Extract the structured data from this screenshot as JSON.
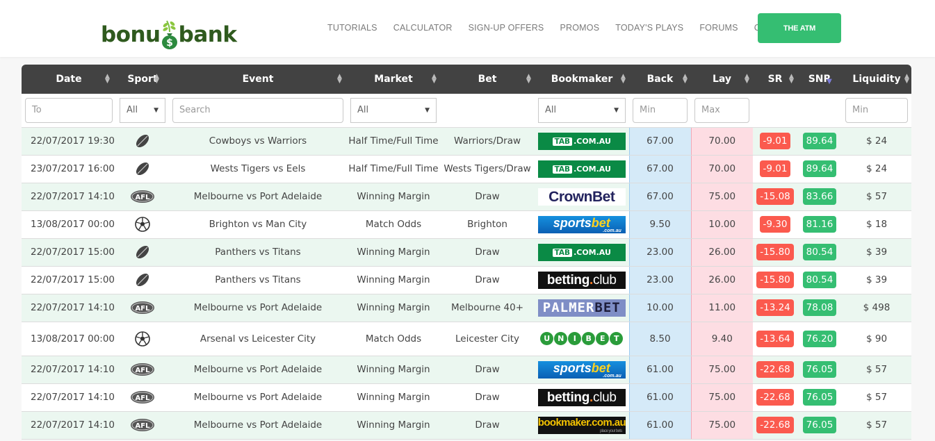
{
  "header": {
    "logo_left": "bonu",
    "logo_right": "bank",
    "nav": [
      "TUTORIALS",
      "CALCULATOR",
      "SIGN-UP OFFERS",
      "PROMOS",
      "TODAY'S PLAYS",
      "FORUMS",
      "CHAT"
    ],
    "cta_label": "THE ATM"
  },
  "colors": {
    "brand_green": "#35be72",
    "header_dark": "#424242",
    "sr_red": "#fb5a4e",
    "back_blue": "#d5eaf8",
    "lay_pink": "#fddde3",
    "row_alt": "#ebf7f0"
  },
  "table": {
    "columns": [
      {
        "key": "date",
        "label": "Date",
        "sort": "both"
      },
      {
        "key": "sport",
        "label": "Sport",
        "sort": "both"
      },
      {
        "key": "event",
        "label": "Event",
        "sort": "both"
      },
      {
        "key": "market",
        "label": "Market",
        "sort": "both"
      },
      {
        "key": "bet",
        "label": "Bet",
        "sort": "both"
      },
      {
        "key": "bookmaker",
        "label": "Bookmaker",
        "sort": "both"
      },
      {
        "key": "back",
        "label": "Back",
        "sort": "both"
      },
      {
        "key": "lay",
        "label": "Lay",
        "sort": "both"
      },
      {
        "key": "sr",
        "label": "SR",
        "sort": "both"
      },
      {
        "key": "snr",
        "label": "SNR",
        "sort": "desc"
      },
      {
        "key": "liquidity",
        "label": "Liquidity",
        "sort": "both"
      }
    ],
    "filters": {
      "date_placeholder": "To",
      "sport_value": "All",
      "event_placeholder": "Search",
      "market_value": "All",
      "bookmaker_value": "All",
      "back_placeholder": "Min",
      "lay_placeholder": "Max",
      "liquidity_placeholder": "Min"
    },
    "rows": [
      {
        "date": "22/07/2017 19:30",
        "sport": "rugby-league",
        "event": "Cowboys vs Warriors",
        "market": "Half Time/Full Time",
        "bet": "Warriors/Draw",
        "bookmaker": "tab",
        "back": "67.00",
        "lay": "70.00",
        "sr": "-9.01",
        "snr": "89.64",
        "liquidity": "$ 24"
      },
      {
        "date": "23/07/2017 16:00",
        "sport": "rugby-league",
        "event": "Wests Tigers vs Eels",
        "market": "Half Time/Full Time",
        "bet": "Wests Tigers/Draw",
        "bookmaker": "tab",
        "back": "67.00",
        "lay": "70.00",
        "sr": "-9.01",
        "snr": "89.64",
        "liquidity": "$ 24"
      },
      {
        "date": "22/07/2017 14:10",
        "sport": "afl",
        "event": "Melbourne vs Port Adelaide",
        "market": "Winning Margin",
        "bet": "Draw",
        "bookmaker": "crownbet",
        "back": "67.00",
        "lay": "75.00",
        "sr": "-15.08",
        "snr": "83.66",
        "liquidity": "$ 57"
      },
      {
        "date": "13/08/2017 00:00",
        "sport": "soccer",
        "event": "Brighton vs Man City",
        "market": "Match Odds",
        "bet": "Brighton",
        "bookmaker": "sportsbet",
        "back": "9.50",
        "lay": "10.00",
        "sr": "-9.30",
        "snr": "81.16",
        "liquidity": "$ 18"
      },
      {
        "date": "22/07/2017 15:00",
        "sport": "rugby-league",
        "event": "Panthers vs Titans",
        "market": "Winning Margin",
        "bet": "Draw",
        "bookmaker": "tab",
        "back": "23.00",
        "lay": "26.00",
        "sr": "-15.80",
        "snr": "80.54",
        "liquidity": "$ 39"
      },
      {
        "date": "22/07/2017 15:00",
        "sport": "rugby-league",
        "event": "Panthers vs Titans",
        "market": "Winning Margin",
        "bet": "Draw",
        "bookmaker": "bettingclub",
        "back": "23.00",
        "lay": "26.00",
        "sr": "-15.80",
        "snr": "80.54",
        "liquidity": "$ 39"
      },
      {
        "date": "22/07/2017 14:10",
        "sport": "afl",
        "event": "Melbourne vs Port Adelaide",
        "market": "Winning Margin",
        "bet": "Melbourne 40+",
        "bookmaker": "palmerbet",
        "back": "10.00",
        "lay": "11.00",
        "sr": "-13.24",
        "snr": "78.08",
        "liquidity": "$ 498"
      },
      {
        "date": "13/08/2017 00:00",
        "sport": "soccer",
        "event": "Arsenal vs Leicester City",
        "market": "Match Odds",
        "bet": "Leicester City",
        "bookmaker": "unibet",
        "back": "8.50",
        "lay": "9.40",
        "sr": "-13.64",
        "snr": "76.20",
        "liquidity": "$ 90"
      },
      {
        "date": "22/07/2017 14:10",
        "sport": "afl",
        "event": "Melbourne vs Port Adelaide",
        "market": "Winning Margin",
        "bet": "Draw",
        "bookmaker": "sportsbet",
        "back": "61.00",
        "lay": "75.00",
        "sr": "-22.68",
        "snr": "76.05",
        "liquidity": "$ 57"
      },
      {
        "date": "22/07/2017 14:10",
        "sport": "afl",
        "event": "Melbourne vs Port Adelaide",
        "market": "Winning Margin",
        "bet": "Draw",
        "bookmaker": "bettingclub",
        "back": "61.00",
        "lay": "75.00",
        "sr": "-22.68",
        "snr": "76.05",
        "liquidity": "$ 57"
      },
      {
        "date": "22/07/2017 14:10",
        "sport": "afl",
        "event": "Melbourne vs Port Adelaide",
        "market": "Winning Margin",
        "bet": "Draw",
        "bookmaker": "bookmaker",
        "back": "61.00",
        "lay": "75.00",
        "sr": "-22.68",
        "snr": "76.05",
        "liquidity": "$ 57"
      }
    ]
  },
  "bookmaker_logos": {
    "tab": {
      "main": "TAB",
      "sub": ".COM.AU"
    },
    "crownbet": {
      "text": "CrownBet"
    },
    "sportsbet": {
      "main": "sports",
      "accent": "bet",
      "sub": ".com.au"
    },
    "bettingclub": {
      "main": "betting",
      "dot": ".",
      "accent": "club"
    },
    "palmerbet": {
      "main": "PALMER",
      "accent": "BET"
    },
    "unibet": {
      "letters": [
        "U",
        "N",
        "I",
        "B",
        "E",
        "T"
      ]
    },
    "bookmaker": {
      "main": "bookmaker.com.au",
      "sub": "place your bets"
    }
  }
}
